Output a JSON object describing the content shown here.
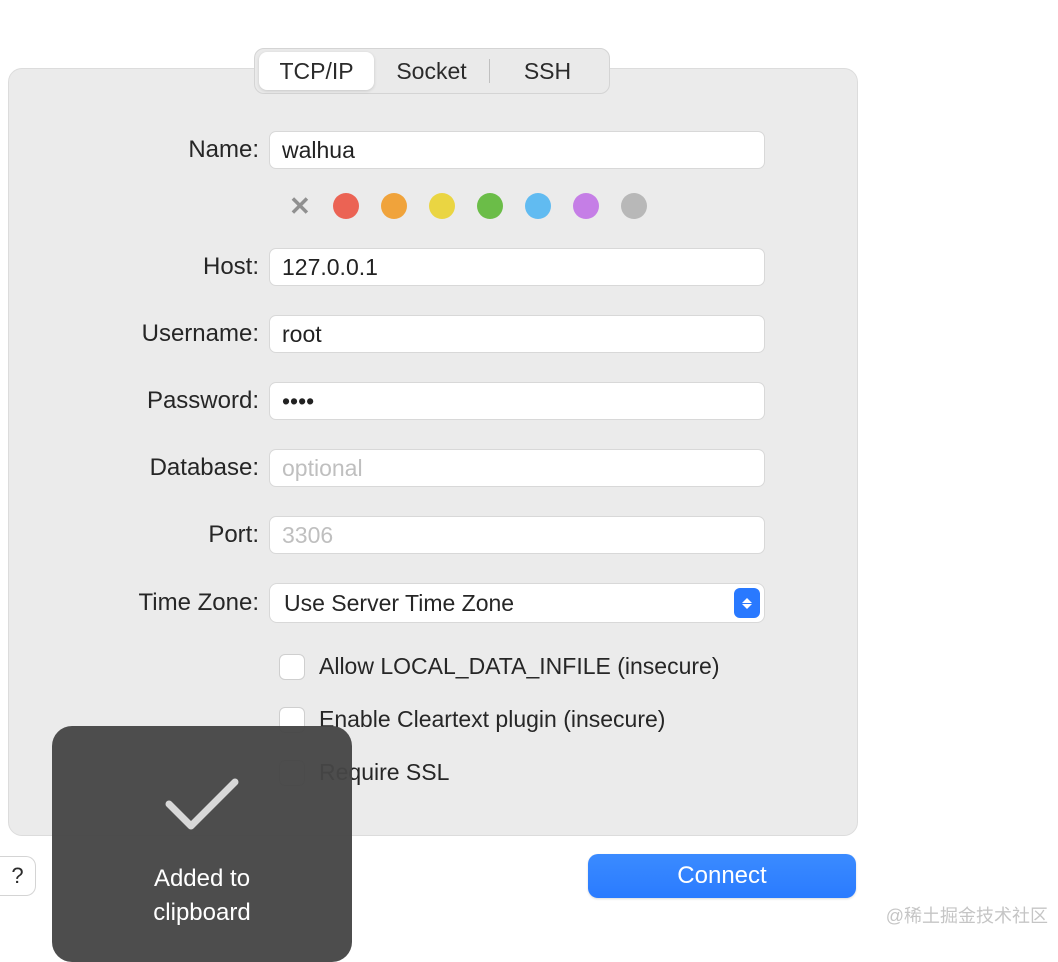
{
  "tabs": {
    "tcpip": "TCP/IP",
    "socket": "Socket",
    "ssh": "SSH"
  },
  "labels": {
    "name": "Name:",
    "host": "Host:",
    "username": "Username:",
    "password": "Password:",
    "database": "Database:",
    "port": "Port:",
    "timezone": "Time Zone:"
  },
  "values": {
    "name": "walhua",
    "host": "127.0.0.1",
    "username": "root",
    "password": "••••",
    "database": "",
    "port": ""
  },
  "placeholders": {
    "database": "optional",
    "port": "3306"
  },
  "timezone_selected": "Use Server Time Zone",
  "colors": {
    "red": "#eb6354",
    "orange": "#f0a33b",
    "yellow": "#ead542",
    "green": "#6bbd48",
    "blue": "#61bbf1",
    "purple": "#c57ee6",
    "gray": "#b8b8b8"
  },
  "checkboxes": {
    "local_infile": "Allow LOCAL_DATA_INFILE (insecure)",
    "cleartext": "Enable Cleartext plugin (insecure)",
    "require_ssl": "Require SSL"
  },
  "connect": "Connect",
  "help": "?",
  "toast": {
    "line1": "Added to",
    "line2": "clipboard"
  },
  "watermark": "@稀土掘金技术社区"
}
